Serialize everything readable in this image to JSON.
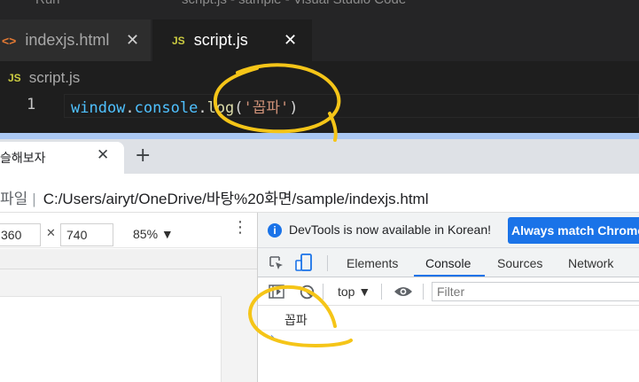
{
  "vscode": {
    "title_bar": {
      "menu_run": "Run",
      "window_title": "script.js - sample - Visual Studio Code"
    },
    "tabs": [
      {
        "label": "indexjs.html",
        "icon": "html-icon",
        "active": false
      },
      {
        "label": "script.js",
        "icon": "js-icon",
        "active": true
      }
    ],
    "file_badge": "JS",
    "html_badge": "<>",
    "close_glyph": "✕",
    "breadcrumb": {
      "file": "script.js"
    },
    "editor": {
      "line_number": "1",
      "code": {
        "object": "window",
        "dot1": ".",
        "property": "console",
        "dot2": ".",
        "method": "log",
        "open_paren": "(",
        "string": "'꼽파'",
        "close_paren": ")"
      }
    }
  },
  "browser": {
    "tab": {
      "title": "슬해보자",
      "close": "✕"
    },
    "new_tab": "+",
    "url": {
      "site": "파일",
      "separator": "|",
      "path": "C:/Users/airyt/OneDrive/바탕%20화면/sample/indexjs.html"
    },
    "device_toolbar": {
      "width": "360",
      "times": "✕",
      "height": "740",
      "zoom": "85% ▼",
      "more": "⋮"
    }
  },
  "devtools": {
    "info_icon": "i",
    "info_text": "DevTools is now available in Korean!",
    "match_button": "Always match Chrome's language",
    "tabs": [
      "Elements",
      "Console",
      "Sources",
      "Network"
    ],
    "active_tab": "Console",
    "console_toolbar": {
      "context": "top ▼",
      "filter_placeholder": "Filter"
    },
    "console_output": [
      "꼽파"
    ],
    "prompt": "›"
  },
  "colors": {
    "accent": "#1a73e8",
    "annotation": "#f5c518",
    "editor_bg": "#1e1e1e"
  }
}
